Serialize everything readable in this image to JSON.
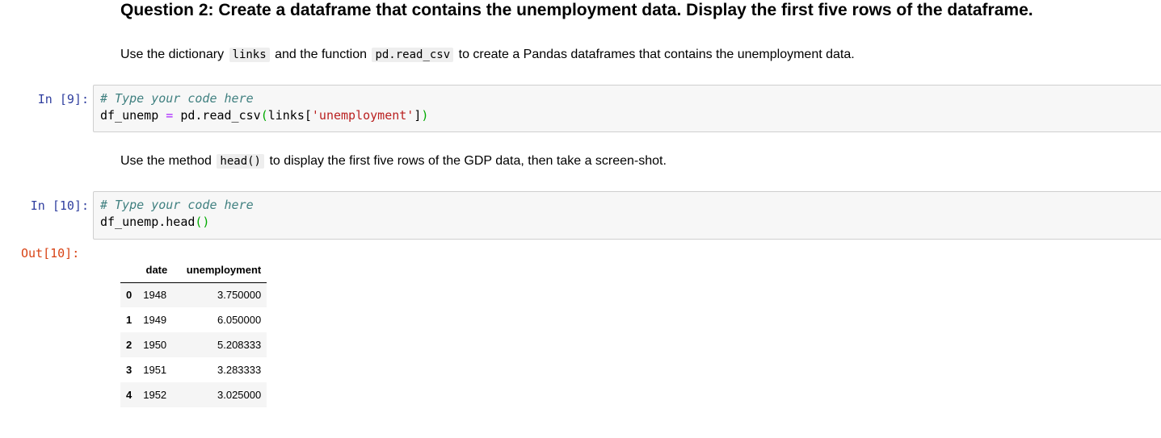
{
  "question": {
    "title": "Question 2: Create a dataframe that contains the unemployment data. Display the first five rows of the dataframe."
  },
  "instruction1": {
    "before": "Use the dictionary",
    "code1": "links",
    "middle": "and the function",
    "code2": "pd.read_csv",
    "after": "to create a Pandas dataframes that contains the unemployment data."
  },
  "cell9": {
    "prompt": "In [9]:",
    "comment": "# Type your code here",
    "var": "df_unemp",
    "op": "=",
    "call": "pd.read_csv",
    "open_paren": "(",
    "arg_before": "links[",
    "arg_string": "'unemployment'",
    "arg_after": "]",
    "close_paren": ")"
  },
  "instruction2": {
    "before": "Use the method",
    "code": "head()",
    "after": "to display the first five rows of the GDP data, then take a screen-shot."
  },
  "cell10": {
    "prompt": "In [10]:",
    "comment": "# Type your code here",
    "call": "df_unemp.head",
    "parens": "()",
    "out_prompt": "Out[10]:"
  },
  "dataframe": {
    "columns": [
      "",
      "date",
      "unemployment"
    ],
    "rows": [
      {
        "index": "0",
        "date": "1948",
        "unemployment": "3.750000"
      },
      {
        "index": "1",
        "date": "1949",
        "unemployment": "6.050000"
      },
      {
        "index": "2",
        "date": "1950",
        "unemployment": "5.208333"
      },
      {
        "index": "3",
        "date": "1951",
        "unemployment": "3.283333"
      },
      {
        "index": "4",
        "date": "1952",
        "unemployment": "3.025000"
      }
    ]
  }
}
